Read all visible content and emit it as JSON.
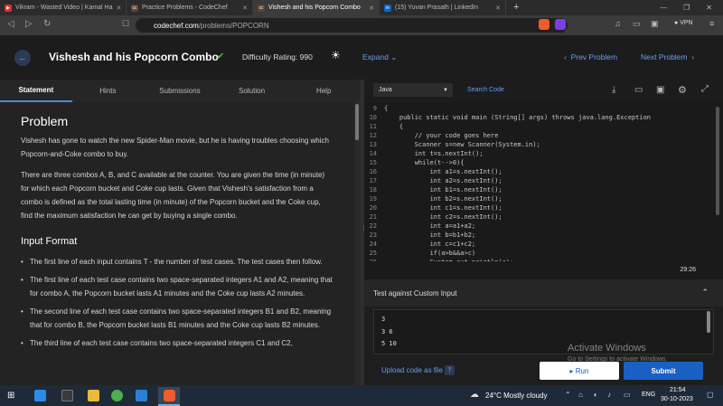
{
  "browser": {
    "tabs": [
      {
        "label": "Vikram - Wasted Video | Kamal Ha",
        "icon_color": "#e52d27",
        "active": false
      },
      {
        "label": "Practice Problems - CodeChef",
        "icon_color": "#5b4638",
        "active": false
      },
      {
        "label": "Vishesh and his Popcorn Combo",
        "icon_color": "#5b4638",
        "active": true
      },
      {
        "label": "(15) Yuvan Prasath | LinkedIn",
        "icon_color": "#0a66c2",
        "active": false
      }
    ],
    "url_host": "codechef.com",
    "url_path": "/problems/POPCORN",
    "vpn_label": "VPN"
  },
  "header": {
    "title": "Vishesh and his Popcorn Combo",
    "difficulty": "Difficulty Rating: 990",
    "expand_label": "Expand",
    "prev_label": "Prev Problem",
    "next_label": "Next Problem"
  },
  "left_tabs": [
    "Statement",
    "Hints",
    "Submissions",
    "Solution",
    "Help"
  ],
  "problem": {
    "heading": "Problem",
    "p1": "Vishesh has gone to watch the new Spider-Man movie, but he is having troubles choosing which Popcorn-and-Coke combo to buy.",
    "p2": "There are three combos A, B, and C available at the counter. You are given the time (in minute) for which each Popcorn bucket and Coke cup lasts. Given that Vishesh's satisfaction from a combo is defined as the total lasting time (in minute) of the Popcorn bucket and the Coke cup, find the maximum satisfaction he can get by buying a single combo.",
    "input_heading": "Input Format",
    "bullets": [
      "The first line of each input contains T - the number of test cases. The test cases then follow.",
      "The first line of each test case contains two space-separated integers A1 and A2, meaning that for combo A, the Popcorn bucket lasts A1 minutes and the Coke cup lasts A2 minutes.",
      "The second line of each test case contains two space-separated integers B1 and B2, meaning that for combo B, the Popcorn bucket lasts B1 minutes and the Coke cup lasts B2 minutes.",
      "The third line of each test case contains two space-separated integers C1 and C2,"
    ]
  },
  "editor": {
    "language": "Java",
    "search_label": "Search Code",
    "lines": [
      {
        "n": "9",
        "text": "{"
      },
      {
        "n": "10",
        "text": "    public static void main (String[] args) throws java.lang.Exception"
      },
      {
        "n": "11",
        "text": "    {"
      },
      {
        "n": "12",
        "text": "        // your code goes here"
      },
      {
        "n": "13",
        "text": "        Scanner s=new Scanner(System.in);"
      },
      {
        "n": "14",
        "text": "        int t=s.nextInt();"
      },
      {
        "n": "15",
        "text": "        while(t-->0){"
      },
      {
        "n": "16",
        "text": "            int a1=s.nextInt();"
      },
      {
        "n": "17",
        "text": "            int a2=s.nextInt();"
      },
      {
        "n": "18",
        "text": "            int b1=s.nextInt();"
      },
      {
        "n": "19",
        "text": "            int b2=s.nextInt();"
      },
      {
        "n": "20",
        "text": "            int c1=s.nextInt();"
      },
      {
        "n": "21",
        "text": "            int c2=s.nextInt();"
      },
      {
        "n": "22",
        "text": "            int a=a1+a2;"
      },
      {
        "n": "23",
        "text": "            int b=b1+b2;"
      },
      {
        "n": "24",
        "text": "            int c=c1+c2;"
      },
      {
        "n": "25",
        "text": "            if(a>b&&a>c)"
      },
      {
        "n": "26",
        "text": "            System.out.println(a);"
      }
    ],
    "cursor_pos": "29:26"
  },
  "custom": {
    "title": "Test against Custom Input",
    "lines": [
      "3",
      "3 6",
      "5 10"
    ]
  },
  "actions": {
    "upload_label": "Upload code as file",
    "run_label": "Run",
    "submit_label": "Submit"
  },
  "watermark": {
    "line1": "Activate Windows",
    "line2": "Go to Settings to activate Windows."
  },
  "taskbar": {
    "weather": "24°C  Mostly cloudy",
    "lang": "ENG",
    "time": "21:54",
    "date": "30-10-2023"
  }
}
